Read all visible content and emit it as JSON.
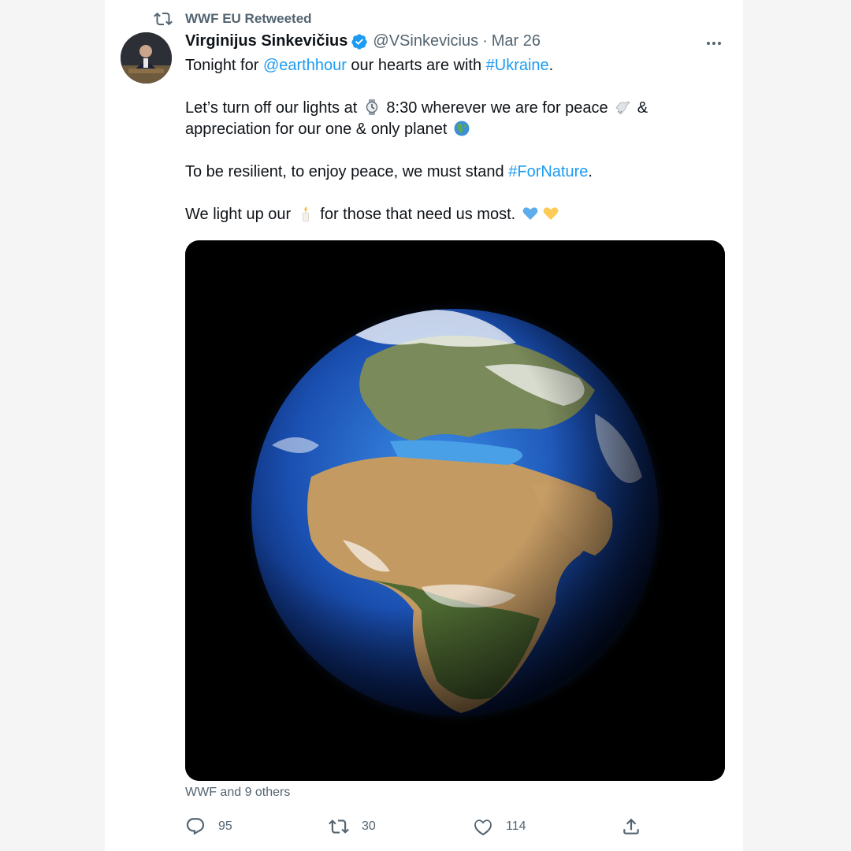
{
  "retweet_header": {
    "label": "WWF EU Retweeted",
    "icon": "retweet-icon"
  },
  "author": {
    "name": "Virginijus Sinkevičius",
    "handle": "@VSinkevicius",
    "separator": "·",
    "date": "Mar 26",
    "verified": true,
    "verified_color": "#1d9bf0"
  },
  "tweet": {
    "p1": {
      "pre": "Tonight for ",
      "mention": "@earthhour",
      "mid": " our hearts are with ",
      "hashtag": "#Ukraine",
      "post": "."
    },
    "p2": {
      "a": "Let’s turn off our lights at ",
      "b": " 8:30 wherever we are for peace ",
      "c": " & appreciation for our one & only planet "
    },
    "p3": {
      "pre": "To be resilient, to enjoy peace, we must stand ",
      "hashtag": "#ForNature",
      "post": "."
    },
    "p4": {
      "pre": "We light up our ",
      "post": " for those that need us most. "
    },
    "emojis": [
      "watch-emoji",
      "dove-emoji",
      "earth-africa-emoji",
      "candle-emoji",
      "blue-heart-emoji",
      "yellow-heart-emoji"
    ]
  },
  "liked_by": "WWF and 9 others",
  "actions": {
    "replies": "95",
    "retweets": "30",
    "likes": "114"
  },
  "colors": {
    "link": "#1d9bf0",
    "text": "#0f1419",
    "secondary": "#536471"
  }
}
